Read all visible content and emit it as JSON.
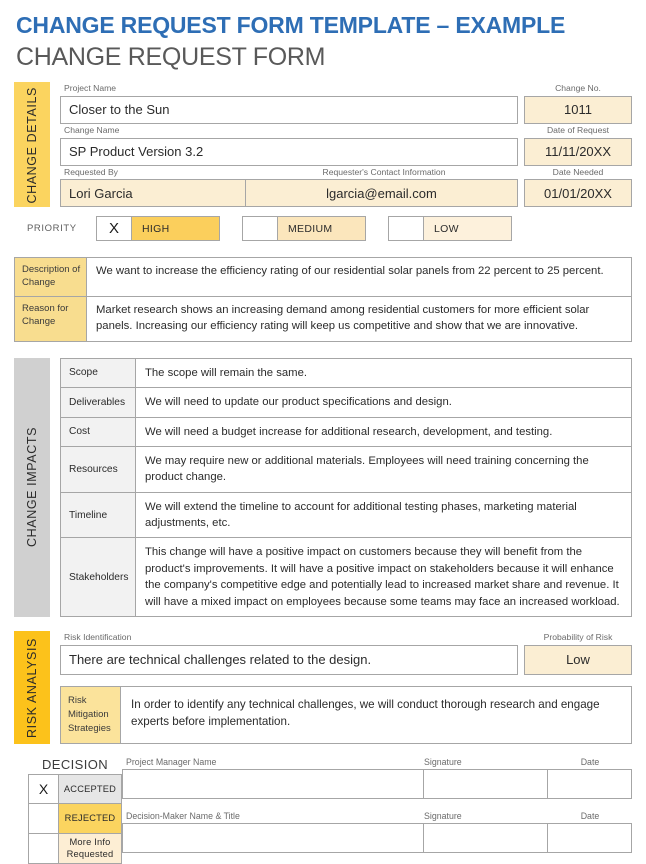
{
  "header": {
    "title": "CHANGE REQUEST FORM TEMPLATE – EXAMPLE",
    "subtitle": "CHANGE REQUEST FORM"
  },
  "change_details": {
    "section_label": "CHANGE DETAILS",
    "project_name_label": "Project Name",
    "project_name_value": "Closer to the Sun",
    "change_no_label": "Change No.",
    "change_no_value": "1011",
    "change_name_label": "Change Name",
    "change_name_value": "SP Product Version 3.2",
    "date_of_request_label": "Date of Request",
    "date_of_request_value": "11/11/20XX",
    "requested_by_label": "Requested By",
    "requested_by_value": "Lori Garcia",
    "contact_label": "Requester's Contact Information",
    "contact_value": "lgarcia@email.com",
    "date_needed_label": "Date Needed",
    "date_needed_value": "01/01/20XX",
    "priority_label": "PRIORITY",
    "priority_options": [
      {
        "name": "HIGH",
        "checked": "X"
      },
      {
        "name": "MEDIUM",
        "checked": ""
      },
      {
        "name": "LOW",
        "checked": ""
      }
    ]
  },
  "description_table": {
    "rows": [
      {
        "label": "Description of Change",
        "text": "We want to increase the efficiency rating of our residential solar panels from 22 percent to 25 percent."
      },
      {
        "label": "Reason for Change",
        "text": "Market research shows an increasing demand among residential customers for more efficient solar panels. Increasing our efficiency rating will keep us competitive and show that we are innovative."
      }
    ]
  },
  "change_impacts": {
    "section_label": "CHANGE IMPACTS",
    "rows": [
      {
        "label": "Scope",
        "text": "The scope will remain the same."
      },
      {
        "label": "Deliverables",
        "text": "We will need to update our product specifications and design."
      },
      {
        "label": "Cost",
        "text": "We will need a budget increase for additional research, development, and testing."
      },
      {
        "label": "Resources",
        "text": "We may require new or additional materials. Employees will need training concerning the product change."
      },
      {
        "label": "Timeline",
        "text": "We will extend the timeline to account for additional testing phases, marketing material adjustments, etc."
      },
      {
        "label": "Stakeholders",
        "text": "This change will have a positive impact on customers because they will benefit from the product's improvements. It will have a positive impact on stakeholders because it will enhance the company's competitive edge and potentially lead to increased market share and revenue. It will have a mixed impact on employees because some teams may face an increased workload."
      }
    ]
  },
  "risk_analysis": {
    "section_label": "RISK ANALYSIS",
    "risk_identification_label": "Risk Identification",
    "risk_identification_value": "There are technical challenges related to the design.",
    "probability_label": "Probability of Risk",
    "probability_value": "Low",
    "mitigation_label": "Risk Mitigation Strategies",
    "mitigation_text": "In order to identify any technical challenges, we will conduct thorough research and engage experts before implementation."
  },
  "decision": {
    "title": "DECISION",
    "options": [
      {
        "name": "ACCEPTED",
        "checked": "X"
      },
      {
        "name": "REJECTED",
        "checked": ""
      },
      {
        "name": "More Info Requested",
        "checked": ""
      }
    ],
    "signature_block_1": {
      "name_label": "Project Manager Name",
      "signature_label": "Signature",
      "date_label": "Date",
      "name_value": "",
      "signature_value": "",
      "date_value": ""
    },
    "signature_block_2": {
      "name_label": "Decision-Maker Name & Title",
      "signature_label": "Signature",
      "date_label": "Date",
      "name_value": "",
      "signature_value": "",
      "date_value": ""
    }
  },
  "colors": {
    "title_blue": "#2e6eb5",
    "subtitle_gray": "#595959",
    "gold_bar": "#fbd45f",
    "gold_bar_strong": "#fcc21b",
    "gray_bar": "#d0d0d0",
    "cream_field": "#fbeed3",
    "label_gold": "#f8dd8f",
    "impact_label_gray": "#f2f2f2"
  }
}
